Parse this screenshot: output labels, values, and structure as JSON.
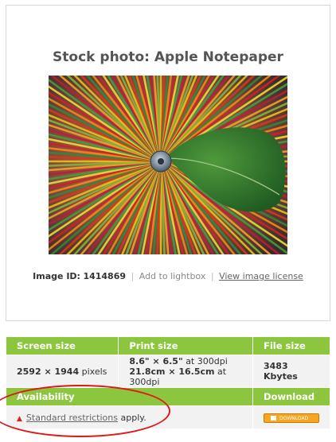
{
  "photo": {
    "title": "Stock photo: Apple Notepaper",
    "image_id_label": "Image ID:",
    "image_id": "1414869",
    "add_to_lightbox": "Add to lightbox",
    "view_license": "View image license"
  },
  "details": {
    "headers": {
      "screen_size": "Screen size",
      "print_size": "Print size",
      "file_size": "File size"
    },
    "screen_size": {
      "value": "2592 × 1944",
      "unit": "pixels"
    },
    "print_size": {
      "line1_value": "8.6\" × 6.5\"",
      "line1_suffix": "at 300dpi",
      "line2_value": "21.8cm × 16.5cm",
      "line2_suffix": "at 300dpi"
    },
    "file_size": "3483 Kbytes",
    "availability_header": "Availability",
    "download_header": "Download",
    "restrictions_link": "Standard restrictions",
    "restrictions_suffix": "apply.",
    "download_button": "DOWNLOAD"
  },
  "colors": {
    "header_green": "#8cc63f",
    "annotation_red": "#e01818",
    "download_orange": "#f5a623"
  },
  "icons": [
    "warning-icon",
    "floppy-disk-icon"
  ]
}
